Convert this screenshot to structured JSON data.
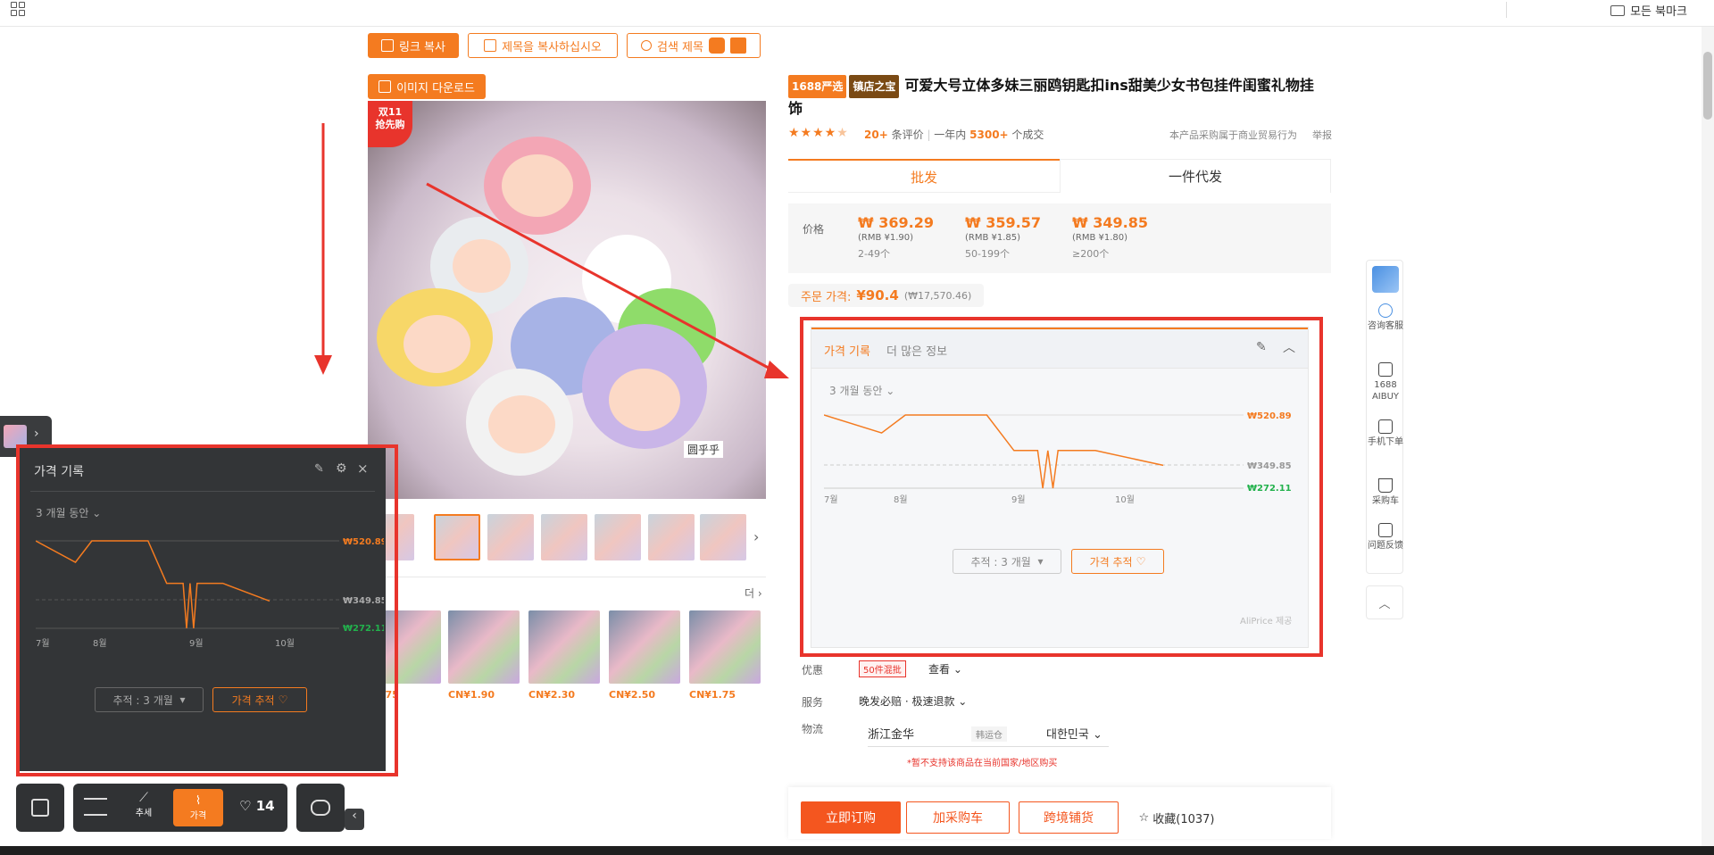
{
  "browser": {
    "bookmarks_label": "모든 북마크"
  },
  "toolbar": {
    "copy_link": "링크 복사",
    "copy_title": "제목을 복사하십시오",
    "search_title": "검색 제목",
    "download_images": "이미지 다운로드"
  },
  "gallery": {
    "promo_badge_line1": "双11",
    "promo_badge_line2": "抢先购",
    "watermark": "圆乎乎"
  },
  "related": {
    "more_label": "더",
    "prices": [
      "¥1.75",
      "CN¥1.90",
      "CN¥2.30",
      "CN¥2.50",
      "CN¥1.75"
    ]
  },
  "product": {
    "badge_yanxuan": "1688严选",
    "badge_treasure": "镇店之宝",
    "title": "可爱大号立体多妹三丽鸥钥匙扣ins甜美少女书包挂件闺蜜礼物挂饰",
    "rating": 4.5,
    "reviews_count": "20+",
    "reviews_label": "条评价",
    "sales_prefix": "一年内",
    "sales_count": "5300+",
    "sales_label": "个成交",
    "notice": "本产品采购属于商业贸易行为",
    "report": "举报"
  },
  "purchase_tabs": {
    "wholesale": "批发",
    "dropship": "一件代发"
  },
  "pricing": {
    "label": "价格",
    "tiers": [
      {
        "krw": "₩ 369.29",
        "rmb": "(RMB ¥1.90)",
        "qty": "2-49个"
      },
      {
        "krw": "₩ 359.57",
        "rmb": "(RMB ¥1.85)",
        "qty": "50-199个"
      },
      {
        "krw": "₩ 349.85",
        "rmb": "(RMB ¥1.80)",
        "qty": "≥200个"
      }
    ],
    "order_price_label": "주문 가격:",
    "order_price": "¥90.4",
    "order_price_krw": "(₩17,570.46)"
  },
  "price_history_right": {
    "tab_history": "가격 기록",
    "tab_more": "더 많은 정보",
    "period": "3 개월 동안",
    "track_select": "추적 : 3 개월",
    "track_button": "가격 추적",
    "provider": "AliPrice 제공"
  },
  "price_history_left": {
    "title": "가격 기록",
    "period": "3 개월 동안",
    "track_select": "추적 : 3 개월",
    "track_button": "가격 추적"
  },
  "chart_data": [
    {
      "type": "line",
      "title": "가격 기록",
      "x_ticks": [
        "7월",
        "8월",
        "9월",
        "10월"
      ],
      "series": [
        {
          "values": [
            520.89,
            460,
            520.89,
            520.89,
            520.89,
            400,
            400,
            272.11,
            400,
            272.11,
            400,
            400,
            349.85
          ]
        }
      ],
      "max_label": "₩520.89",
      "current_label": "₩349.85",
      "min_label": "₩272.11",
      "colors": {
        "line": "#f47b20",
        "max": "#f47b20",
        "min": "#22b14c"
      }
    }
  ],
  "details": {
    "promo_label": "优惠",
    "promo_tag": "50件混批",
    "promo_view": "查看",
    "service_label": "服务",
    "service_value": "晚发必赔 · 极速退款",
    "logistics_label": "物流",
    "origin": "浙江金华",
    "transit": "韩运仓",
    "destination": "대한민국",
    "warning": "*暂不支持该商品在当前国家/地区购买"
  },
  "actions": {
    "buy_now": "立即订购",
    "add_cart": "加采购车",
    "cross_border": "跨境铺货",
    "favorite": "收藏(1037)"
  },
  "side_tools": [
    {
      "icon": "translate-icon",
      "label": ""
    },
    {
      "icon": "chat-icon",
      "label": "咨询客服"
    },
    {
      "icon": "ai-icon",
      "label": "1688 AIBUY"
    },
    {
      "icon": "qr-icon",
      "label": "手机下单"
    },
    {
      "icon": "cart-icon",
      "label": "采购车"
    },
    {
      "icon": "edit-icon",
      "label": "问题反馈"
    }
  ],
  "ext_toolbar": {
    "trend": "추세",
    "price": "가격",
    "wishlist_count": "14"
  }
}
